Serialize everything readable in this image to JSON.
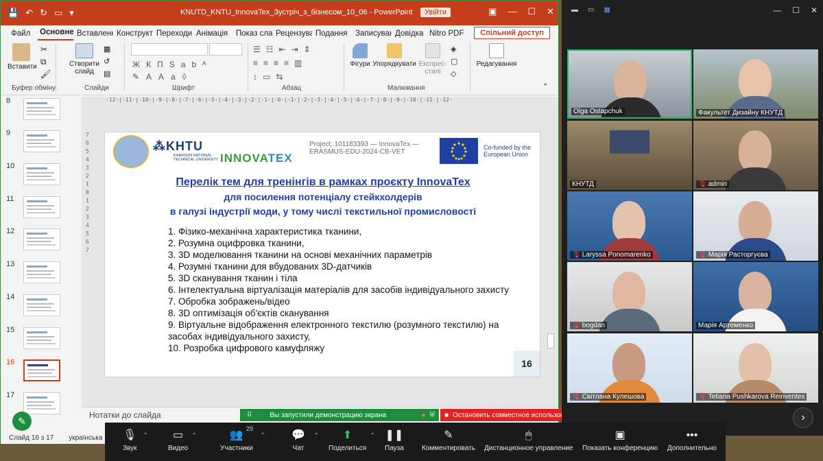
{
  "ppt": {
    "title": "KNUTD_KNTU_InnovaTex_Зустріч_з_бізнесом_10_06  -  PowerPoint",
    "signin": "Увійти",
    "share": "Спільний доступ",
    "tabs": [
      "Файл",
      "Основне",
      "Вставлення",
      "Конструктор",
      "Переходи",
      "Анімація",
      "Показ слайдів",
      "Рецензування",
      "Подання",
      "Записування",
      "Довідка",
      "Nitro PDF"
    ],
    "ribbon": {
      "paste": "Вставити",
      "new_slide": "Створити слайд",
      "shapes": "Фігури",
      "arrange": "Упорядкувати",
      "quick_styles": "Експрес-стилі",
      "editing": "Редагування",
      "groups": [
        "Буфер обміну",
        "Слайди",
        "Шрифт",
        "Абзац",
        "Малювання"
      ]
    },
    "thumb_numbers": [
      "8",
      "9",
      "10",
      "11",
      "12",
      "13",
      "14",
      "15",
      "16",
      "17"
    ],
    "notes": "Нотатки до слайда",
    "status_slide": "Слайд 16 з 17",
    "status_lang": "українська",
    "ruler_h": "·12·|·11·|·10·|·9·|·8·|·7·|·6·|·5·|·4·|·3·|·2·|·1·|·0·|·1·|·2·|·3·|·4·|·5·|·6·|·7·|·8·|·9·|·10·|·11·|·12·",
    "ruler_v": [
      "7",
      "6",
      "5",
      "4",
      "3",
      "2",
      "1",
      "0",
      "1",
      "2",
      "3",
      "4",
      "5",
      "6",
      "7"
    ]
  },
  "slide": {
    "kntu": "⁂KHTU",
    "kntu_sub": "KHERSON NATIONAL TECHNICAL UNIVERSITY",
    "innova_a": "INNOVA",
    "innova_b": "TEX",
    "project_line1": "Project: 101183393 — InnovaTex —",
    "project_line2": "ERASMUS-EDU-2024-CB-VET",
    "cofund1": "Co-funded by the",
    "cofund2": "European Union",
    "title1": "Перелік тем для тренінгів  в рамках проєкту InnovaTex",
    "title2": "для посилення потенціалу стейкхолдерів",
    "title3": "в галузі індустрії моди, у тому числі текстильної промисловості",
    "items": [
      "1. Фізико-механічна характеристика тканини,",
      "2. Розумна оцифровка тканини,",
      "3. 3D моделювання тканини на основі механічних параметрів",
      "4. Розумні тканини для вбудованих 3D-датчиків",
      "5. 3D сканування тканин і тіла",
      "6. Інтелектуальна віртуалізація матеріалів для засобів індивідуального захисту",
      "7. Обробка зображень/відео",
      "8. 3D оптимізація об'єктів сканування",
      "9. Віртуальне відображення електронного текстилю (розумного текстилю) на засобах індивідуального захисту,",
      "10. Розробка цифрового камуфляжу"
    ],
    "page": "16"
  },
  "banners": {
    "sharing": "Вы запустили демонстрацию экрана",
    "stop": "Остановить совместное использование"
  },
  "participants": [
    {
      "name": "Olga Ostapchuk",
      "muted": false
    },
    {
      "name": "Факультет Дизайну КНУТД",
      "muted": false
    },
    {
      "name": "КНУТД",
      "muted": false
    },
    {
      "name": "admin",
      "muted": true
    },
    {
      "name": "Laryssa Ponomarenko",
      "muted": true
    },
    {
      "name": "Марія Расторгуєва",
      "muted": true
    },
    {
      "name": "bogdan",
      "muted": true
    },
    {
      "name": "Марія Артеменко",
      "muted": false
    },
    {
      "name": "Світлана Кулешова",
      "muted": true
    },
    {
      "name": "Tetiana Pushkarova Reinventex",
      "muted": true
    }
  ],
  "zoom_toolbar": {
    "audio": "Звук",
    "video": "Видео",
    "participants": "Участники",
    "participants_count": "29",
    "chat": "Чат",
    "share": "Поделиться",
    "pause": "Пауза",
    "annotate": "Комментировать",
    "remote": "Дистанционное управление",
    "show_conf": "Показать конференцию",
    "more": "Дополнительно"
  }
}
